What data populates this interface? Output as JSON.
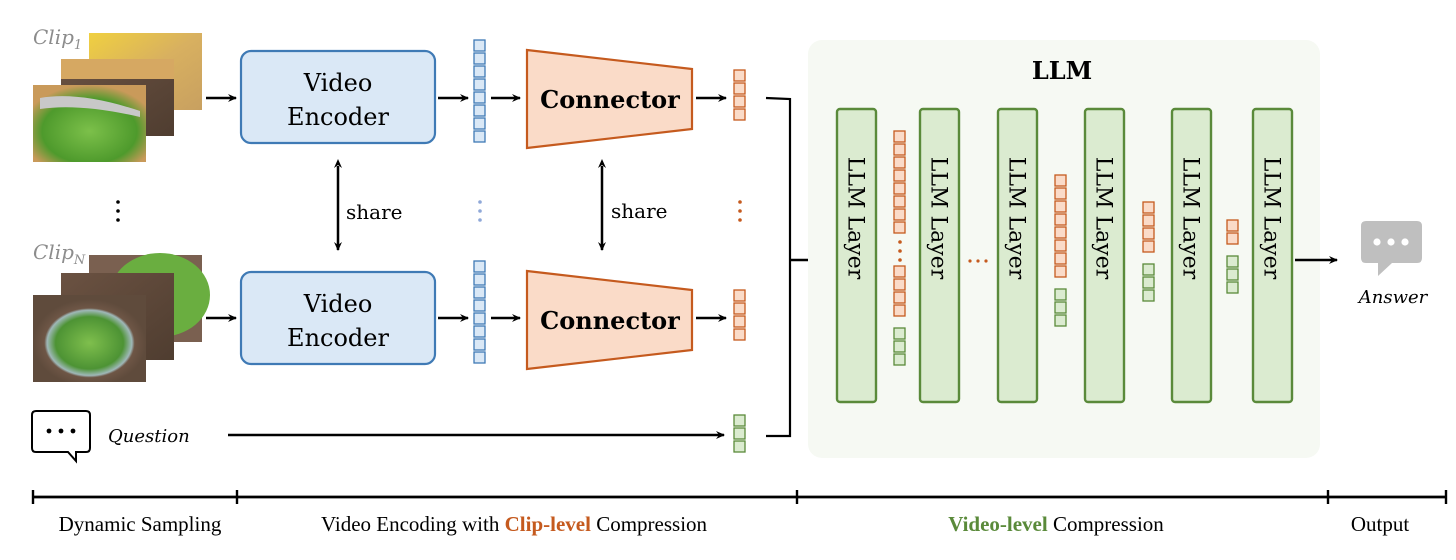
{
  "colors": {
    "blue_fill": "#dae8f6",
    "blue_stroke": "#3f7ab5",
    "orange_fill": "#fadbc8",
    "orange_stroke": "#c55a1e",
    "green_fill": "#dbebd0",
    "green_stroke": "#5a8a3a",
    "llm_panel": "#f6f9f3",
    "gray_icon": "#bfbfbf",
    "clip_label": "#8c8c8c",
    "black": "#000000"
  },
  "clips": {
    "first_label": "Clip",
    "first_sub": "1",
    "last_label": "Clip",
    "last_sub": "N",
    "ellipsis": "⋮"
  },
  "question": {
    "label": "Question",
    "icon": "speech-bubble-dots-icon"
  },
  "encoder": {
    "line1": "Video",
    "line2": "Encoder",
    "share_label": "share",
    "token_count": 8
  },
  "connector": {
    "label": "Connector",
    "share_label": "share",
    "token_count": 4
  },
  "question_tokens": 3,
  "llm": {
    "title": "LLM",
    "layer_label": "LLM Layer",
    "layer_count": 6,
    "between_layers": [
      {
        "orange_top": 8,
        "dots": true,
        "orange_bottom": 4,
        "green": 3
      },
      {
        "ellipsis": true
      },
      {
        "orange_top": 8,
        "green": 3
      },
      {
        "orange_top": 4,
        "green": 3
      },
      {
        "orange_top": 2,
        "green": 3
      }
    ]
  },
  "answer": {
    "label": "Answer",
    "icon": "speech-bubble-dots-icon"
  },
  "timeline": {
    "sections": [
      {
        "parts": [
          {
            "text": "Dynamic Sampling",
            "style": "plain"
          }
        ]
      },
      {
        "parts": [
          {
            "text": "Video Encoding with ",
            "style": "plain"
          },
          {
            "text": "Clip-level",
            "style": "orange-bold"
          },
          {
            "text": " Compression",
            "style": "plain"
          }
        ]
      },
      {
        "parts": [
          {
            "text": "Video-level",
            "style": "green-bold"
          },
          {
            "text": " Compression",
            "style": "plain"
          }
        ]
      },
      {
        "parts": [
          {
            "text": "Output",
            "style": "plain"
          }
        ]
      }
    ]
  }
}
